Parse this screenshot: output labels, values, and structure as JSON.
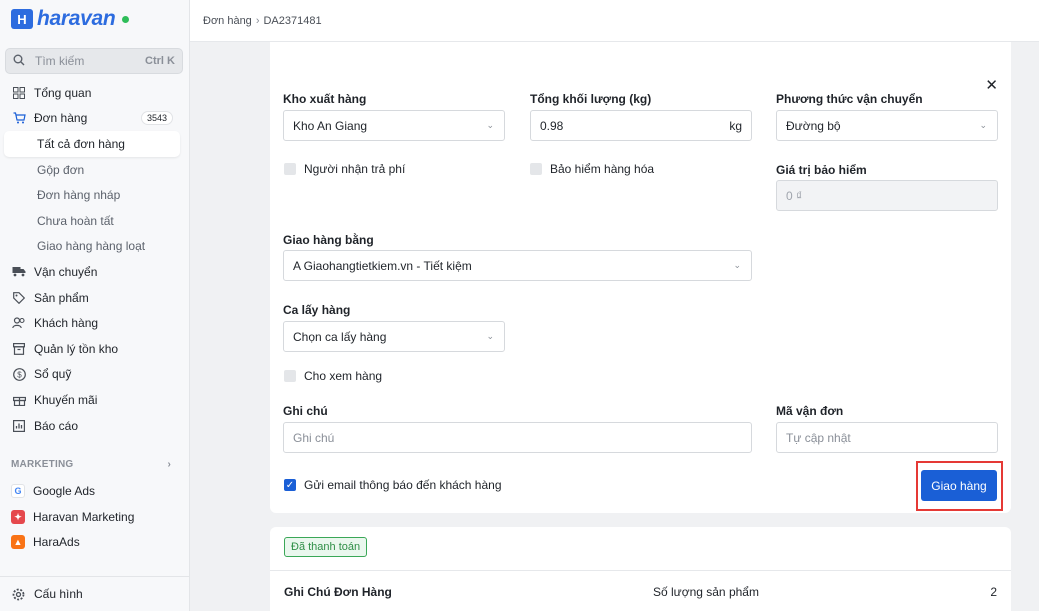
{
  "brand": {
    "name": "haravan",
    "mark": "H",
    "status_color": "#2ebd59"
  },
  "search": {
    "placeholder": "Tìm kiếm",
    "shortcut": "Ctrl K"
  },
  "nav": {
    "overview": "Tổng quan",
    "orders": "Đơn hàng",
    "orders_count": "3543",
    "orders_sub": [
      "Tất cả đơn hàng",
      "Gộp đơn",
      "Đơn hàng nháp",
      "Chưa hoàn tất",
      "Giao hàng hàng loạt"
    ],
    "shipping": "Vận chuyển",
    "products": "Sản phẩm",
    "customers": "Khách hàng",
    "inventory": "Quản lý tồn kho",
    "cashbook": "Sổ quỹ",
    "promotions": "Khuyến mãi",
    "reports": "Báo cáo"
  },
  "marketing": {
    "title": "MARKETING",
    "items": [
      "Google Ads",
      "Haravan Marketing",
      "HaraAds"
    ]
  },
  "settings_label": "Cấu hình",
  "breadcrumb": {
    "parent": "Đơn hàng",
    "current": "DA2371481"
  },
  "form": {
    "warehouse_label": "Kho xuất hàng",
    "warehouse_value": "Kho An Giang",
    "weight_label": "Tổng khối lượng (kg)",
    "weight_value": "0.98",
    "weight_unit": "kg",
    "method_label": "Phương thức vận chuyển",
    "method_value": "Đường bộ",
    "receiver_pays": "Người nhận trả phí",
    "insurance": "Bảo hiểm hàng hóa",
    "insurance_value_label": "Giá trị bảo hiểm",
    "insurance_value_placeholder": "0 ₫",
    "carrier_label": "Giao hàng bằng",
    "carrier_value": "A Giaohangtietkiem.vn - Tiết kiệm",
    "pickup_label": "Ca lấy hàng",
    "pickup_value": "Chọn ca lấy hàng",
    "allow_view": "Cho xem hàng",
    "note_label": "Ghi chú",
    "note_placeholder": "Ghi chú",
    "tracking_label": "Mã vận đơn",
    "tracking_placeholder": "Tự cập nhật",
    "send_email": "Gửi email thông báo đến khách hàng",
    "send_email_checked": true,
    "submit": "Giao hàng"
  },
  "summary": {
    "paid_badge": "Đã thanh toán",
    "note_title": "Ghi Chú Đơn Hàng",
    "qty_label": "Số lượng sản phẩm",
    "qty_value": "2"
  },
  "colors": {
    "primary": "#1a5fd6",
    "highlight": "#e53935",
    "paid": "#3aa757"
  }
}
